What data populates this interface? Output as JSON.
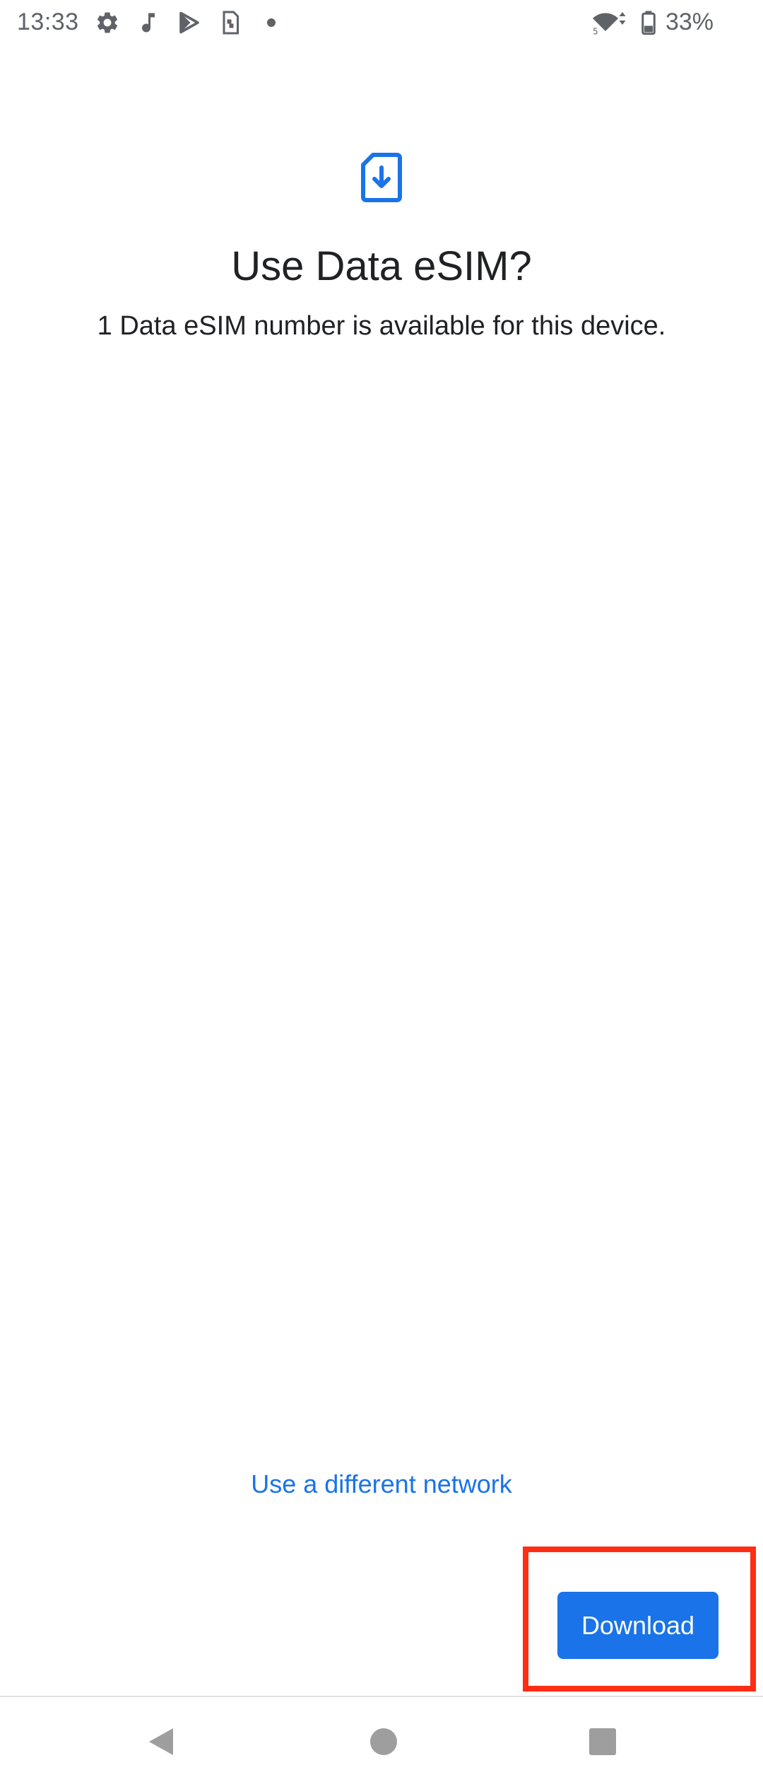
{
  "status_bar": {
    "time": "13:33",
    "battery_percent": "33%",
    "icons": [
      "gear-icon",
      "music-note-icon",
      "play-store-icon",
      "sim-card-icon",
      "dot-icon",
      "wifi-5g-icon",
      "battery-icon"
    ]
  },
  "main": {
    "icon": "esim-download-icon",
    "title": "Use Data eSIM?",
    "subtitle": "1 Data eSIM number is available for this device.",
    "alt_network_link": "Use a different network",
    "download_label": "Download"
  },
  "nav": {
    "icons": [
      "back-icon",
      "home-icon",
      "recents-icon"
    ]
  },
  "colors": {
    "accent": "#1a73e8",
    "highlight": "#ff2d14",
    "text": "#202124",
    "status_text": "#5f6368"
  }
}
